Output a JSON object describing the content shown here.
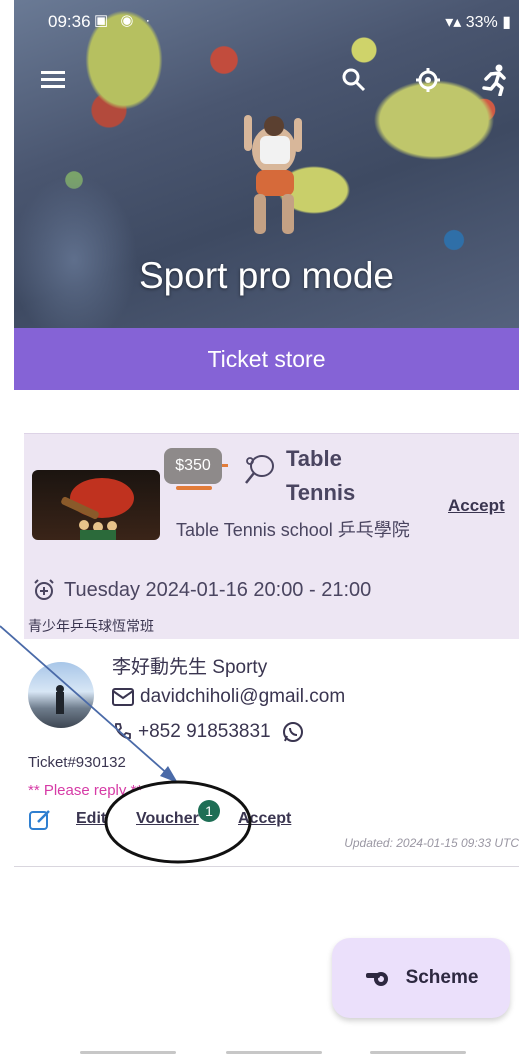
{
  "status": {
    "time": "09:36",
    "battery": "33%"
  },
  "hero": {
    "title": "Sport pro mode"
  },
  "store": {
    "label": "Ticket store"
  },
  "event": {
    "price": "$350",
    "title": "Table Tennis",
    "accept": "Accept",
    "school": "Table Tennis school 乒乓學院",
    "datetime": "Tuesday 2024-01-16 20:00 - 21:00",
    "class_name": "青少年乒乓球恆常班"
  },
  "contact": {
    "name": "李好動先生 Sporty",
    "email": "davidchiholi@gmail.com",
    "phone": "+852 91853831",
    "ticket": "Ticket#930132",
    "please_reply": "** Please reply **"
  },
  "actions": {
    "edit": "Edit",
    "voucher": "Voucher",
    "voucher_badge": "1",
    "accept": "Accept"
  },
  "updated": "Updated: 2024-01-15 09:33 UTC",
  "fab": {
    "label": "Scheme"
  },
  "colors": {
    "primary": "#8563d6",
    "card_bg": "#ede6f3",
    "reply_pink": "#d63ba6",
    "badge_green": "#1e6e55",
    "fab_bg": "#ebe0fb"
  },
  "icons": [
    "menu-icon",
    "search-icon",
    "settings-icon",
    "runner-icon",
    "ping-pong-icon",
    "alarm-icon",
    "mail-icon",
    "phone-icon",
    "whatsapp-icon",
    "edit-icon",
    "whistle-icon"
  ]
}
